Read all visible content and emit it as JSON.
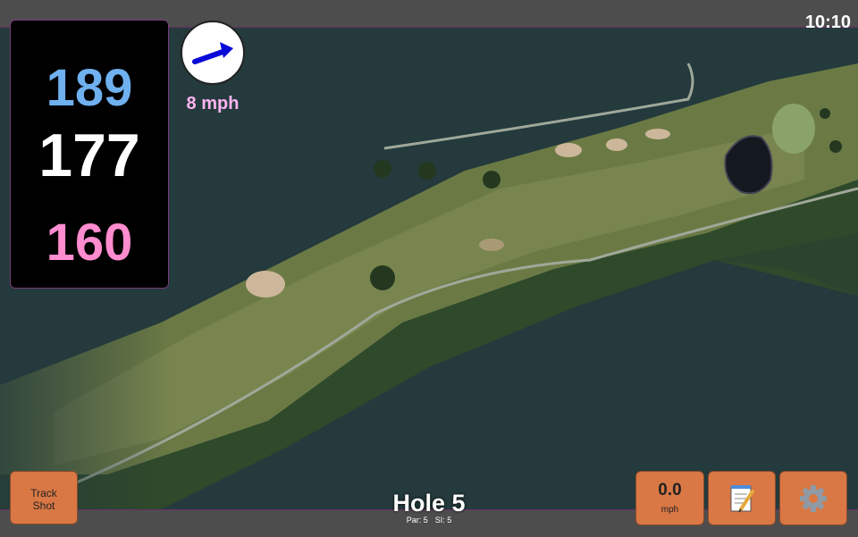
{
  "status": {
    "time": "10:10"
  },
  "distances": {
    "back": "189",
    "middle": "177",
    "front": "160"
  },
  "wind": {
    "speed": "8 mph",
    "icon": "wind-direction-arrow-icon"
  },
  "hole": {
    "title": "Hole 5",
    "par": "Par: 5",
    "si": "SI: 5"
  },
  "buttons": {
    "track_shot": [
      "Track",
      "Shot"
    ],
    "speed_value": "0.0",
    "speed_unit": "mph",
    "notes_icon": "notepad-icon",
    "settings_icon": "gear-icon"
  },
  "colors": {
    "distance_back": "#6fb0ef",
    "distance_middle": "#ffffff",
    "distance_front": "#ff8ccf",
    "wind_speed": "#ffb3f0",
    "button": "#d97845"
  }
}
